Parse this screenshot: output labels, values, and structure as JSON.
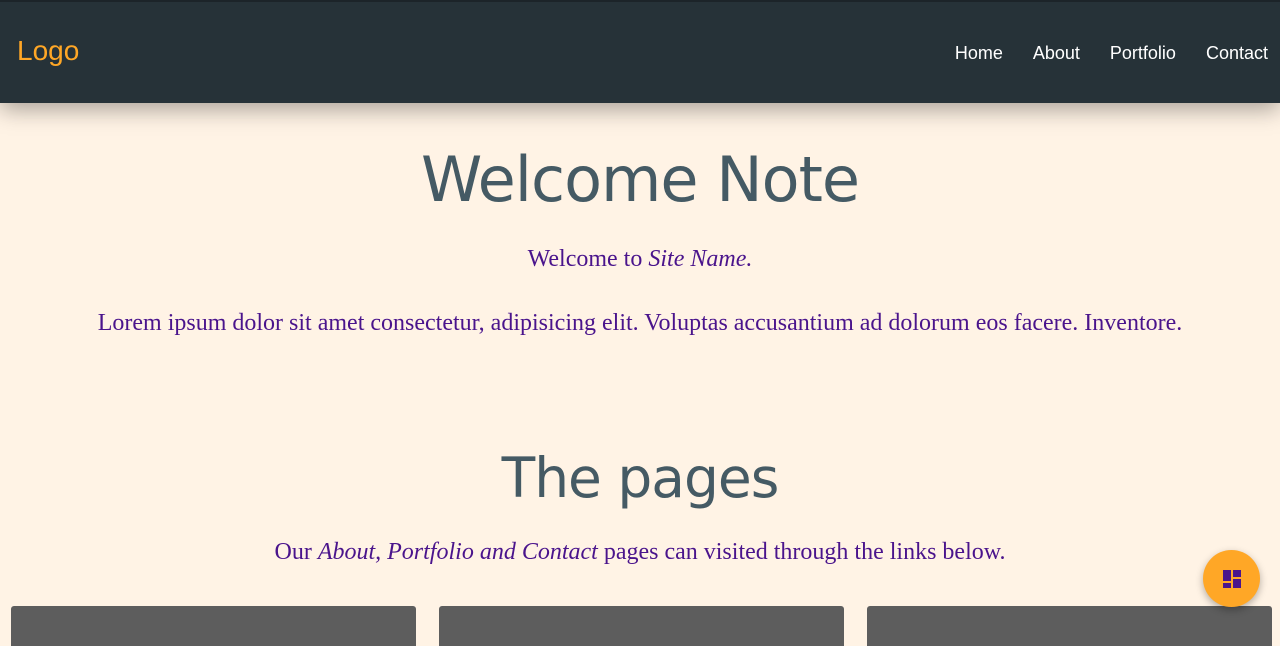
{
  "nav": {
    "logo": "Logo",
    "links": [
      "Home",
      "About",
      "Portfolio",
      "Contact"
    ]
  },
  "welcome": {
    "heading": "Welcome Note",
    "intro_prefix": "Welcome to ",
    "intro_site": "Site Name.",
    "body": "Lorem ipsum dolor sit amet consectetur, adipisicing elit. Voluptas accusantium ad dolorum eos facere. Inventore."
  },
  "pages": {
    "heading": "The pages",
    "text_prefix": "Our ",
    "text_emphasis": "About, Portfolio and Contact",
    "text_suffix": " pages can visited through the links below."
  },
  "fab": {
    "icon": "dashboard-icon"
  },
  "colors": {
    "navbar": "#263238",
    "accent": "#ffa726",
    "heading": "#455a64",
    "text": "#4a148c",
    "background": "#fff3e5",
    "card": "#5d5d5d"
  }
}
